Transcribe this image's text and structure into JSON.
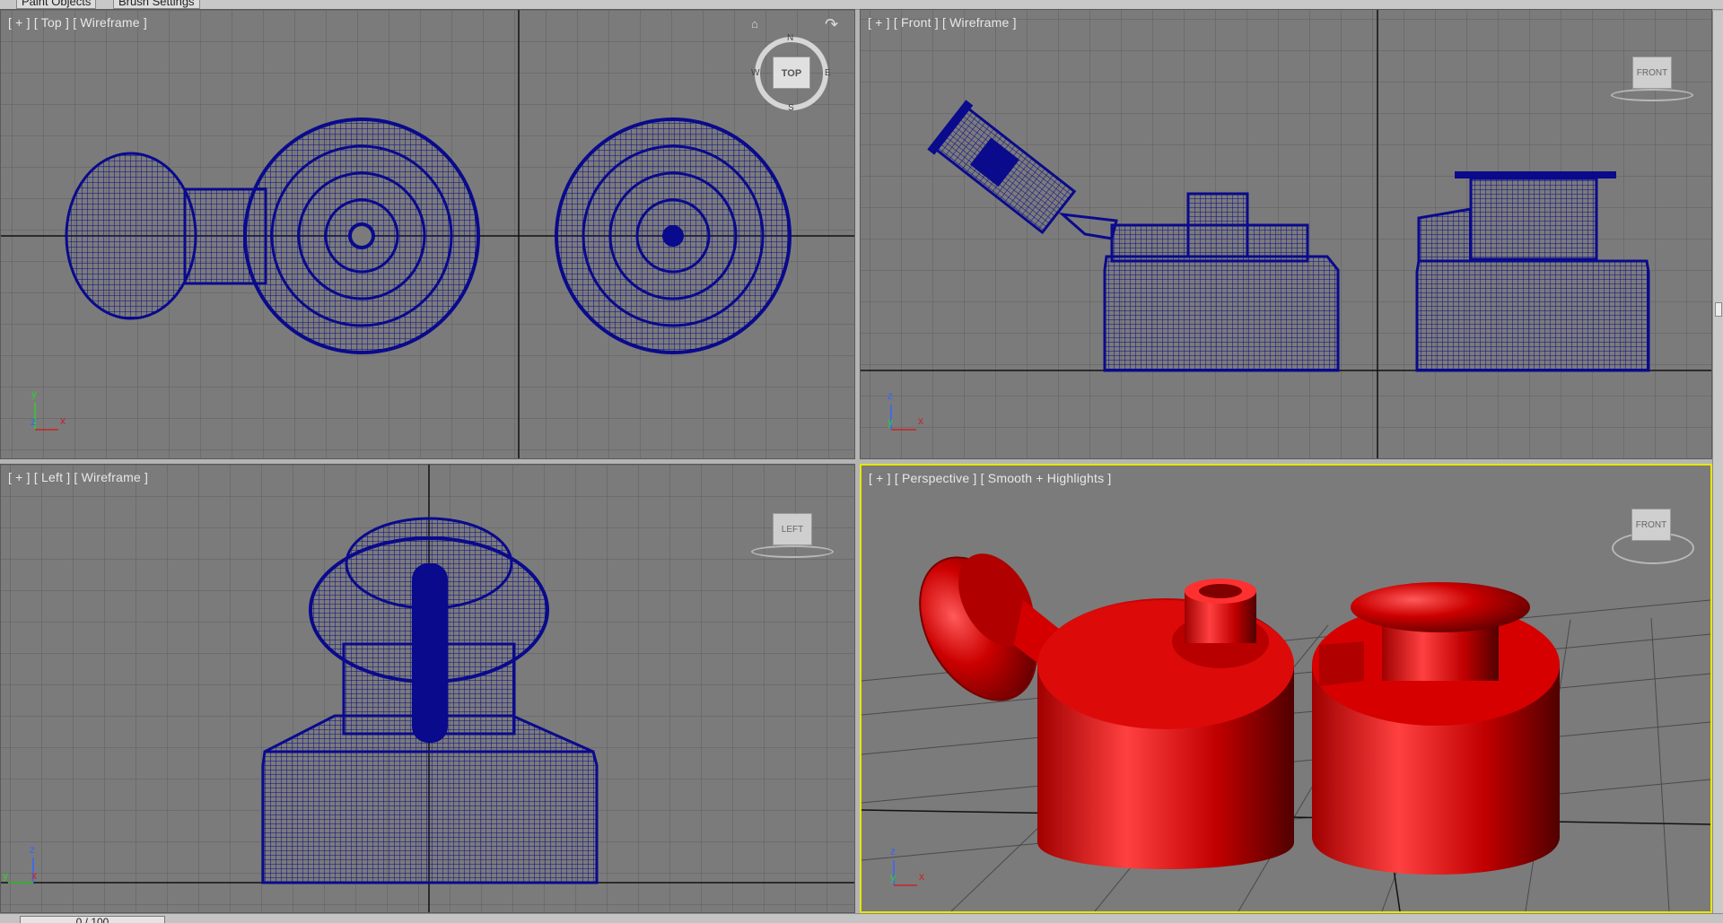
{
  "tabs": [
    "Paint Objects",
    "Brush Settings"
  ],
  "viewports": {
    "top": {
      "label": "[ + ] [ Top ] [ Wireframe ]",
      "nav": "TOP",
      "compass": {
        "n": "N",
        "s": "S",
        "e": "E",
        "w": "W"
      }
    },
    "front": {
      "label": "[ + ] [ Front ] [ Wireframe ]",
      "cube": "FRONT"
    },
    "left": {
      "label": "[ + ] [ Left ] [ Wireframe ]",
      "cube": "LEFT"
    },
    "perspective": {
      "label": "[ + ] [ Perspective ] [ Smooth + Highlights ]",
      "cube": "FRONT"
    }
  },
  "axes": {
    "top": {
      "a": "y",
      "b": "x",
      "c": "z"
    },
    "front": {
      "a": "z",
      "b": "x",
      "c": "y"
    },
    "left": {
      "a": "z",
      "b": "x",
      "c": "y"
    },
    "perspective": {
      "a": "z",
      "b": "x",
      "c": "y"
    }
  },
  "timeslider": "0 / 100",
  "colors": {
    "viewport_bg": "#7b7b7b",
    "grid": "#5f5f5f",
    "wire": "#0a0a8c",
    "shaded": "#cc0000",
    "active_border": "#e6e600"
  }
}
